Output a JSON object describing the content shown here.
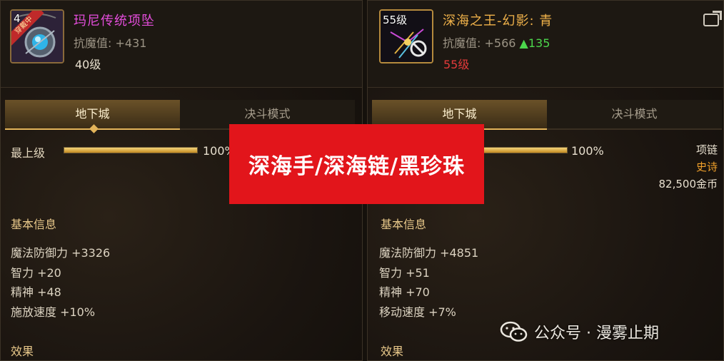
{
  "left": {
    "icon_level": "4",
    "equipped_badge": "穿戴中",
    "item_name": "玛尼传统项坠",
    "item_name_color": "#e54ddc",
    "resist_label": "抗魔值: +431",
    "level": "40级",
    "tabs": [
      "地下城",
      "决斗模式"
    ],
    "progress_label": "最上级",
    "progress_value": 1.0,
    "progress_text": "100%",
    "section_basic": "基本信息",
    "stats": [
      "魔法防御力 +3326",
      "智力 +20",
      "精神 +48",
      "施放速度 +10%"
    ],
    "section_effect": "效果"
  },
  "right": {
    "icon_level": "55级",
    "item_name": "深海之王-幻影: 青",
    "item_name_color": "#f0b24a",
    "resist_label": "抗魔值: +566",
    "resist_bonus": "▲135",
    "resist_bonus_color": "#4cd64c",
    "level": "55级",
    "level_color": "#e23a3a",
    "tabs": [
      "地下城",
      "决斗模式"
    ],
    "progress_value": 1.0,
    "progress_text": "100%",
    "slot": "项链",
    "rarity": "史诗",
    "rarity_color": "#f0a02a",
    "price": "82,500金币",
    "section_basic": "基本信息",
    "stats": [
      "魔法防御力 +4851",
      "智力 +51",
      "精神 +70",
      "移动速度 +7%"
    ],
    "section_effect": "效果"
  },
  "banner_text": "深海手/深海链/黑珍珠",
  "watermark": "公众号 · 漫雾止期",
  "icons": {
    "share": "share-icon",
    "disabled": "prohibited-icon",
    "wechat": "wechat-icon"
  }
}
